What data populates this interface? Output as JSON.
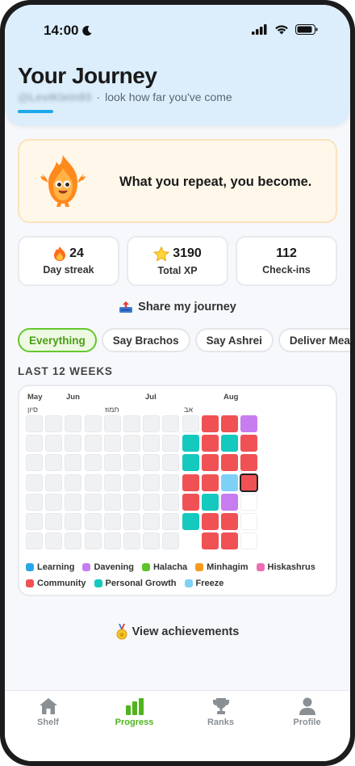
{
  "status_bar": {
    "time": "14:00"
  },
  "header": {
    "title": "Your Journey",
    "handle": "@LeviKlein93",
    "subtitle": "look how far you've come"
  },
  "quote": {
    "text": "What you repeat, you become."
  },
  "stats": [
    {
      "icon": "fire-icon",
      "value": "24",
      "label": "Day streak"
    },
    {
      "icon": "star-icon",
      "value": "3190",
      "label": "Total XP"
    },
    {
      "icon": "",
      "value": "112",
      "label": "Check-ins"
    }
  ],
  "share_label": "Share my journey",
  "chips": [
    {
      "label": "Everything",
      "active": true
    },
    {
      "label": "Say Brachos",
      "active": false
    },
    {
      "label": "Say Ashrei",
      "active": false
    },
    {
      "label": "Deliver Meals",
      "active": false
    }
  ],
  "section_title": "LAST 12 WEEKS",
  "heatmap": {
    "months": [
      "May",
      "Jun",
      "Jul",
      "Aug"
    ],
    "hebrew_months": [
      "סיון",
      "תמוז",
      "אב"
    ],
    "weeks": [
      [
        "none",
        "none",
        "none",
        "none",
        "none",
        "none",
        "none"
      ],
      [
        "none",
        "none",
        "none",
        "none",
        "none",
        "none",
        "none"
      ],
      [
        "none",
        "none",
        "none",
        "none",
        "none",
        "none",
        "none"
      ],
      [
        "none",
        "none",
        "none",
        "none",
        "none",
        "none",
        "none"
      ],
      [
        "none",
        "none",
        "none",
        "none",
        "none",
        "none",
        "none"
      ],
      [
        "none",
        "none",
        "none",
        "none",
        "none",
        "none",
        "none"
      ],
      [
        "none",
        "none",
        "none",
        "none",
        "none",
        "none",
        "none"
      ],
      [
        "none",
        "none",
        "none",
        "none",
        "none",
        "none",
        "none"
      ],
      [
        "none",
        "personal",
        "personal",
        "community",
        "community",
        "personal"
      ],
      [
        "community",
        "community",
        "community",
        "community",
        "personal",
        "community",
        "community"
      ],
      [
        "community",
        "personal",
        "community",
        "freeze",
        "davening",
        "community",
        "community"
      ],
      [
        "davening",
        "community",
        "community",
        "community",
        "empty",
        "empty",
        "empty"
      ]
    ],
    "today": {
      "week": 11,
      "day": 3
    }
  },
  "legend": [
    [
      {
        "label": "Learning",
        "color": "#2aa7e8"
      },
      {
        "label": "Davening",
        "color": "#c77df0"
      },
      {
        "label": "Halacha",
        "color": "#5cc52a"
      },
      {
        "label": "Minhagim",
        "color": "#f59a1c"
      },
      {
        "label": "Hiskashrus",
        "color": "#ef6cb7"
      }
    ],
    [
      {
        "label": "Community",
        "color": "#f05154"
      },
      {
        "label": "Personal Growth",
        "color": "#14c9bd"
      },
      {
        "label": "Freeze",
        "color": "#7fd0f7"
      }
    ]
  ],
  "colors": {
    "community": "#f05154",
    "personal": "#14c9bd",
    "davening": "#c77df0",
    "freeze": "#7fd0f7"
  },
  "achievements_label": "View achievements",
  "tabs": [
    {
      "label": "Shelf",
      "icon": "house-icon",
      "active": false
    },
    {
      "label": "Progress",
      "icon": "bar-chart-icon",
      "active": true
    },
    {
      "label": "Ranks",
      "icon": "trophy-icon",
      "active": false
    },
    {
      "label": "Profile",
      "icon": "person-icon",
      "active": false
    }
  ]
}
